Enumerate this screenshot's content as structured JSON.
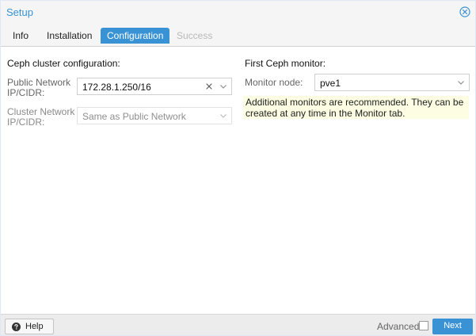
{
  "window": {
    "title": "Setup"
  },
  "tabs": [
    {
      "label": "Info",
      "state": "normal"
    },
    {
      "label": "Installation",
      "state": "normal"
    },
    {
      "label": "Configuration",
      "state": "active"
    },
    {
      "label": "Success",
      "state": "disabled"
    }
  ],
  "left_panel": {
    "title": "Ceph cluster configuration:",
    "public_network": {
      "label_line1": "Public Network",
      "label_line2": "IP/CIDR:",
      "value": "172.28.1.250/16"
    },
    "cluster_network": {
      "label_line1": "Cluster Network",
      "label_line2": "IP/CIDR:",
      "value": "Same as Public Network"
    }
  },
  "right_panel": {
    "title": "First Ceph monitor:",
    "monitor_node": {
      "label": "Monitor node:",
      "value": "pve1"
    },
    "hint": "Additional monitors are recommended. They can be created at any time in the Monitor tab."
  },
  "footer": {
    "help_label": "Help",
    "advanced_label": "Advanced",
    "advanced_checked": false,
    "next_label": "Next"
  },
  "colors": {
    "accent": "#3892d4",
    "hint_background": "#fdfde3",
    "disabled_text": "#b9b9b9"
  },
  "icons": {
    "close": "close-circle-icon",
    "clear": "clear-x-icon",
    "dropdown": "chevron-down-icon",
    "help": "question-circle-icon"
  }
}
